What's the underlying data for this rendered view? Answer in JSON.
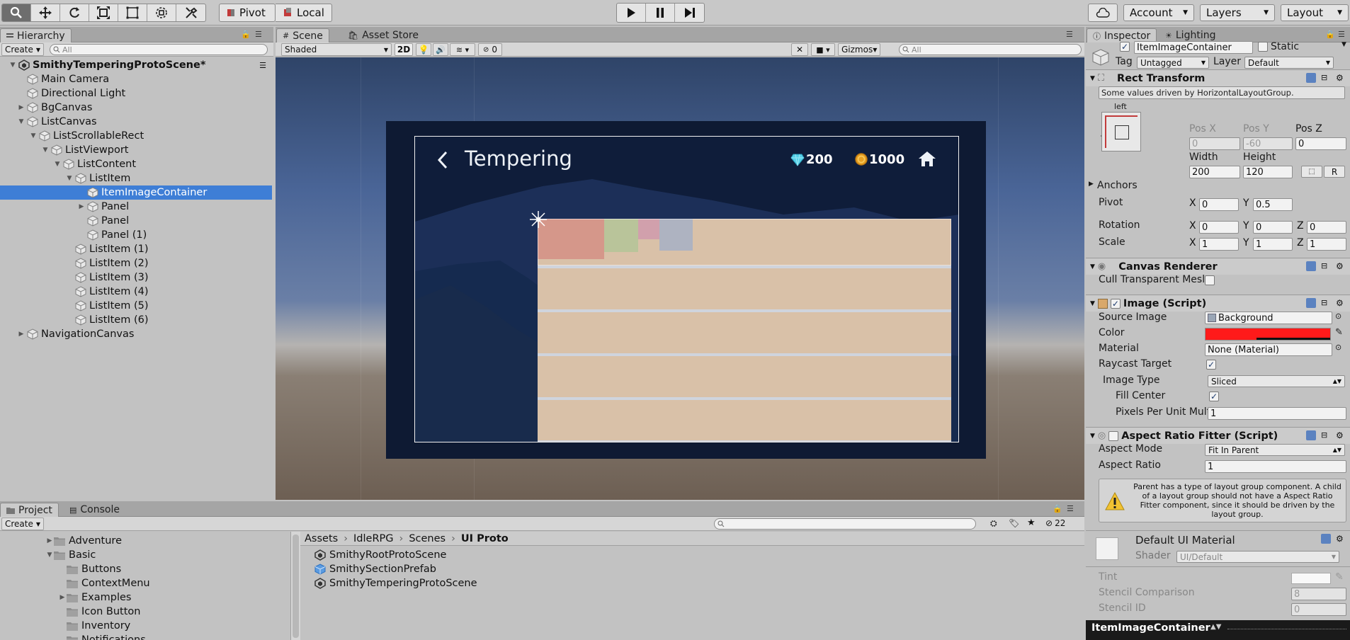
{
  "toolbar": {
    "pivot_label": "Pivot",
    "local_label": "Local",
    "account_label": "Account",
    "layers_label": "Layers",
    "layout_label": "Layout"
  },
  "hierarchy": {
    "tab_label": "Hierarchy",
    "create_label": "Create",
    "search_placeholder": "All",
    "scene_name": "SmithyTemperingProtoScene*",
    "items": [
      {
        "label": "Main Camera"
      },
      {
        "label": "Directional Light"
      },
      {
        "label": "BgCanvas"
      },
      {
        "label": "ListCanvas"
      },
      {
        "label": "ListScrollableRect"
      },
      {
        "label": "ListViewport"
      },
      {
        "label": "ListContent"
      },
      {
        "label": "ListItem"
      },
      {
        "label": "ItemImageContainer"
      },
      {
        "label": "Panel"
      },
      {
        "label": "Panel"
      },
      {
        "label": "Panel (1)"
      },
      {
        "label": "ListItem (1)"
      },
      {
        "label": "ListItem (2)"
      },
      {
        "label": "ListItem (3)"
      },
      {
        "label": "ListItem (4)"
      },
      {
        "label": "ListItem (5)"
      },
      {
        "label": "ListItem (6)"
      },
      {
        "label": "NavigationCanvas"
      }
    ]
  },
  "scene": {
    "tab_scene": "Scene",
    "tab_asset_store": "Asset Store",
    "shading_mode": "Shaded",
    "mode_2d": "2D",
    "hidden_count": "0",
    "gizmos_label": "Gizmos",
    "search_placeholder": "All",
    "game": {
      "title": "Tempering",
      "gems": "200",
      "coins": "1000"
    }
  },
  "inspector": {
    "tab_inspector": "Inspector",
    "tab_lighting": "Lighting",
    "object_name": "ItemImageContainer",
    "static_label": "Static",
    "tag_label": "Tag",
    "tag_value": "Untagged",
    "layer_label": "Layer",
    "layer_value": "Default",
    "rect_transform": {
      "title": "Rect Transform",
      "driven_note": "Some values driven by HorizontalLayoutGroup.",
      "anchor_h": "left",
      "anchor_v": "top",
      "pos_x_label": "Pos X",
      "pos_y_label": "Pos Y",
      "pos_z_label": "Pos Z",
      "pos_x": "0",
      "pos_y": "-60",
      "pos_z": "0",
      "width_label": "Width",
      "height_label": "Height",
      "width": "200",
      "height": "120",
      "r_button": "R",
      "anchors_label": "Anchors",
      "pivot_label": "Pivot",
      "pivot_x": "0",
      "pivot_y": "0.5",
      "rotation_label": "Rotation",
      "rot_x": "0",
      "rot_y": "0",
      "rot_z": "0",
      "scale_label": "Scale",
      "scale_x": "1",
      "scale_y": "1",
      "scale_z": "1",
      "x": "X",
      "y": "Y",
      "z": "Z"
    },
    "canvas_renderer": {
      "title": "Canvas Renderer",
      "cull_label": "Cull Transparent Mesl"
    },
    "image": {
      "title": "Image (Script)",
      "source_image_label": "Source Image",
      "source_image_value": "Background",
      "color_label": "Color",
      "color_value": "#ff1a1a",
      "material_label": "Material",
      "material_value": "None (Material)",
      "raycast_label": "Raycast Target",
      "image_type_label": "Image Type",
      "image_type_value": "Sliced",
      "fill_center_label": "Fill Center",
      "ppu_label": "Pixels Per Unit Mult",
      "ppu_value": "1"
    },
    "aspect": {
      "title": "Aspect Ratio Fitter (Script)",
      "mode_label": "Aspect Mode",
      "mode_value": "Fit In Parent",
      "ratio_label": "Aspect Ratio",
      "ratio_value": "1",
      "warning": "Parent has a type of layout group component. A child of a layout group should not have a Aspect Ratio Fitter component, since it should be driven by the layout group."
    },
    "material": {
      "title": "Default UI Material",
      "shader_label": "Shader",
      "shader_value": "UI/Default",
      "tint_label": "Tint",
      "stencil_comp_label": "Stencil Comparison",
      "stencil_comp_value": "8",
      "stencil_id_label": "Stencil ID",
      "stencil_id_value": "0"
    },
    "preview_label": "ItemImageContainer"
  },
  "project": {
    "tab_project": "Project",
    "tab_console": "Console",
    "create_label": "Create",
    "hidden_count": "22",
    "folders": [
      {
        "label": "Adventure"
      },
      {
        "label": "Basic"
      },
      {
        "label": "Buttons"
      },
      {
        "label": "ContextMenu"
      },
      {
        "label": "Examples"
      },
      {
        "label": "Icon Button"
      },
      {
        "label": "Inventory"
      },
      {
        "label": "Notifications"
      }
    ],
    "breadcrumb": [
      "Assets",
      "IdleRPG",
      "Scenes",
      "UI Proto"
    ],
    "assets": [
      {
        "label": "SmithyRootProtoScene"
      },
      {
        "label": "SmithySectionPrefab"
      },
      {
        "label": "SmithyTemperingProtoScene"
      }
    ]
  },
  "colors": {
    "selection": "#3e7ed6",
    "image_color": "#ff1a1a",
    "list_bg": "#d9c1a8"
  }
}
